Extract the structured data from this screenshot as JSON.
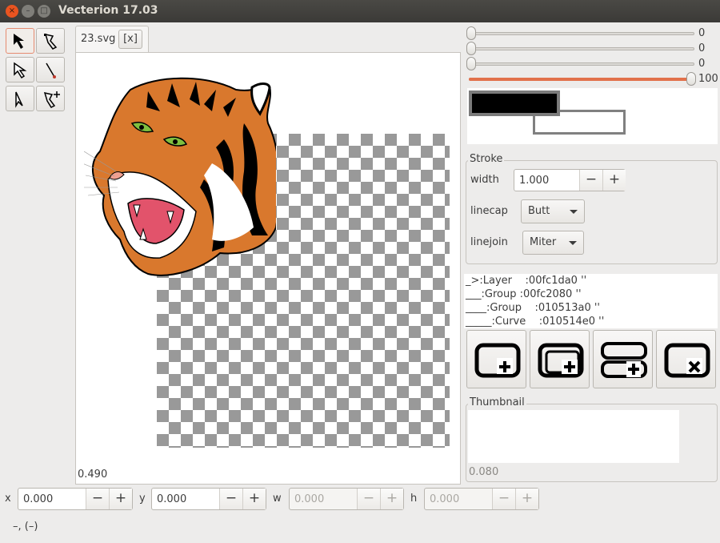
{
  "window": {
    "title": "Vecterion 17.03",
    "close_glyph": "×",
    "min_glyph": "–",
    "max_glyph": "□"
  },
  "document": {
    "tab_title": "23.svg",
    "tab_close": "[x]",
    "zoom": "0.490"
  },
  "sliders": [
    {
      "value": "0",
      "level": 0
    },
    {
      "value": "0",
      "level": 0
    },
    {
      "value": "0",
      "level": 0
    },
    {
      "value": "100",
      "level": 1
    }
  ],
  "colors": {
    "fill": "#000000",
    "stroke": "#ffffff",
    "accent": "#e2714b"
  },
  "stroke": {
    "legend": "Stroke",
    "width_label": "width",
    "width_value": "1.000",
    "linecap_label": "linecap",
    "linecap_value": "Butt",
    "linejoin_label": "linejoin",
    "linejoin_value": "Miter"
  },
  "tree": {
    "items": [
      "_>:Layer    :00fc1da0 ''",
      "___:Group :00fc2080 ''",
      "____:Group    :010513a0 ''",
      "_____:Curve    :010514e0 ''"
    ]
  },
  "layer_buttons": [
    "add-layer-icon",
    "add-group-icon",
    "add-sublayer-icon",
    "delete-layer-icon"
  ],
  "thumbnail": {
    "legend": "Thumbnail",
    "value": "0.080"
  },
  "geometry": {
    "x_label": "x",
    "x_value": "0.000",
    "y_label": "y",
    "y_value": "0.000",
    "w_label": "w",
    "w_value": "0.000",
    "h_label": "h",
    "h_value": "0.000"
  },
  "spin_glyphs": {
    "minus": "−",
    "plus": "+"
  },
  "status": "–, (–)"
}
